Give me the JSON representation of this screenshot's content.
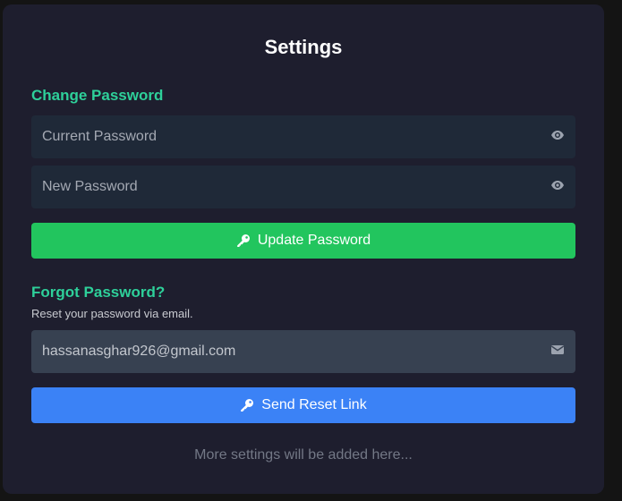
{
  "settings": {
    "title": "Settings",
    "change_password": {
      "heading": "Change Password",
      "current_placeholder": "Current Password",
      "new_placeholder": "New Password",
      "update_button": "Update Password",
      "field_icon": "eye-icon",
      "button_icon": "key-icon"
    },
    "forgot_password": {
      "heading": "Forgot Password?",
      "description": "Reset your password via email.",
      "email_value": "hassanasghar926@gmail.com",
      "field_icon": "envelope-icon",
      "send_button": "Send Reset Link",
      "button_icon": "key-icon"
    },
    "footer_note": "More settings will be added here..."
  },
  "colors": {
    "accent_heading": "#2ed09a",
    "update_button": "#22c55e",
    "send_button": "#3b82f6",
    "card_background": "#1e1e2e"
  }
}
